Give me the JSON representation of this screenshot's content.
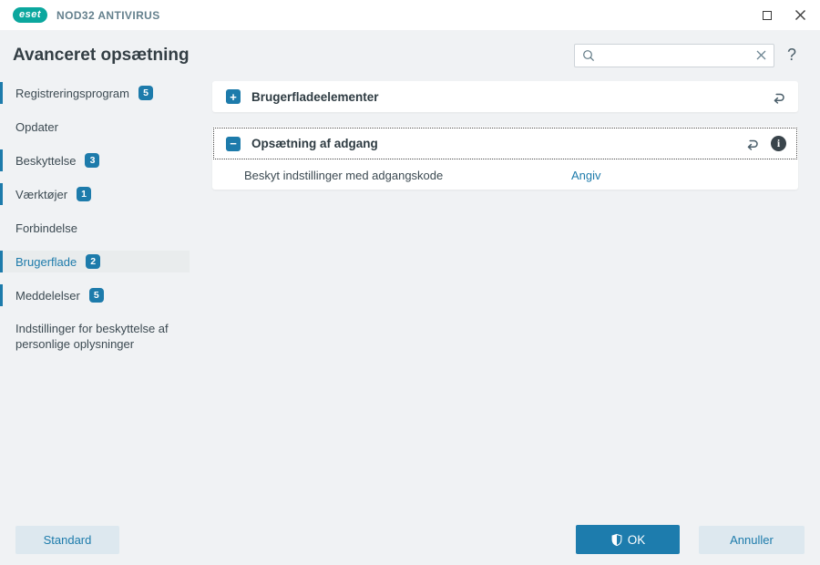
{
  "window": {
    "brand_logo": "eset",
    "product_name": "NOD32 ANTIVIRUS"
  },
  "header": {
    "title": "Avanceret opsætning",
    "search_value": "",
    "help_label": "?"
  },
  "sidebar": {
    "items": [
      {
        "label": "Registreringsprogram",
        "badge": "5"
      },
      {
        "label": "Opdater",
        "badge": ""
      },
      {
        "label": "Beskyttelse",
        "badge": "3"
      },
      {
        "label": "Værktøjer",
        "badge": "1"
      },
      {
        "label": "Forbindelse",
        "badge": ""
      },
      {
        "label": "Brugerflade",
        "badge": "2"
      },
      {
        "label": "Meddelelser",
        "badge": "5"
      },
      {
        "label": "Indstillinger for beskyttelse af personlige oplysninger",
        "badge": ""
      }
    ]
  },
  "main": {
    "sections": [
      {
        "title": "Brugerfladeelementer",
        "toggle_glyph": "+",
        "expanded": false
      },
      {
        "title": "Opsætning af adgang",
        "toggle_glyph": "−",
        "expanded": true,
        "rows": [
          {
            "label": "Beskyt indstillinger med adgangskode",
            "action": "Angiv"
          }
        ]
      }
    ]
  },
  "footer": {
    "standard_label": "Standard",
    "ok_label": "OK",
    "cancel_label": "Annuller"
  },
  "colors": {
    "accent": "#1d7bab",
    "logo_teal": "#0ba79e",
    "primary_button": "#1d7cad",
    "light_button_bg": "#dde8ef",
    "background": "#f0f2f4",
    "card_bg": "#ffffff",
    "selected_item_bg": "#e9eced",
    "info_icon_bg": "#39444b"
  }
}
